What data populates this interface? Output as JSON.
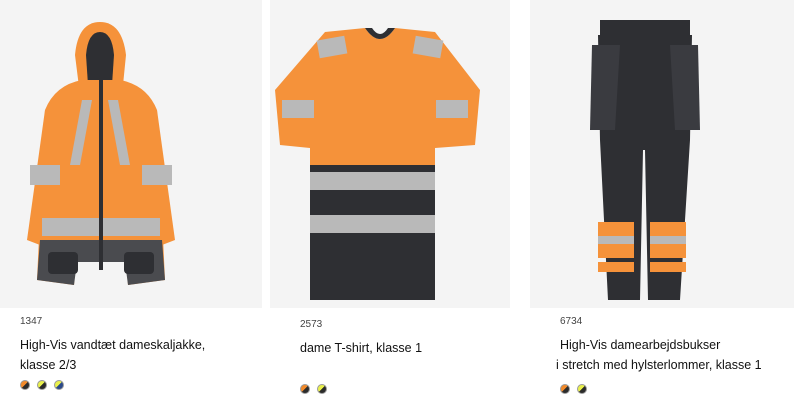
{
  "products": [
    {
      "sku": "1347",
      "title_line1": "High-Vis vandtæt dameskaljakke,",
      "title_line2": "klasse 2/3",
      "swatches": [
        {
          "left": "#f28a2a",
          "right": "#2b2b2b"
        },
        {
          "left": "#e9f04c",
          "right": "#2b2b2b"
        },
        {
          "left": "#e9f04c",
          "right": "#2b4a8a"
        }
      ]
    },
    {
      "sku": "2573",
      "title_line1": "dame T-shirt, klasse 1",
      "swatches": [
        {
          "left": "#f28a2a",
          "right": "#2b2b2b"
        },
        {
          "left": "#e9f04c",
          "right": "#2b2b2b"
        }
      ]
    },
    {
      "sku": "6734",
      "title_line1": "High-Vis damearbejdsbukser",
      "title_line2": "i stretch med hylsterlommer,  klasse 1",
      "swatches": [
        {
          "left": "#f28a2a",
          "right": "#2b2b2b"
        },
        {
          "left": "#e9f04c",
          "right": "#2b2b2b"
        }
      ]
    }
  ],
  "colors": {
    "hivis_orange": "#f5923a",
    "reflective": "#b9b9b9",
    "dark": "#2e2f33"
  }
}
